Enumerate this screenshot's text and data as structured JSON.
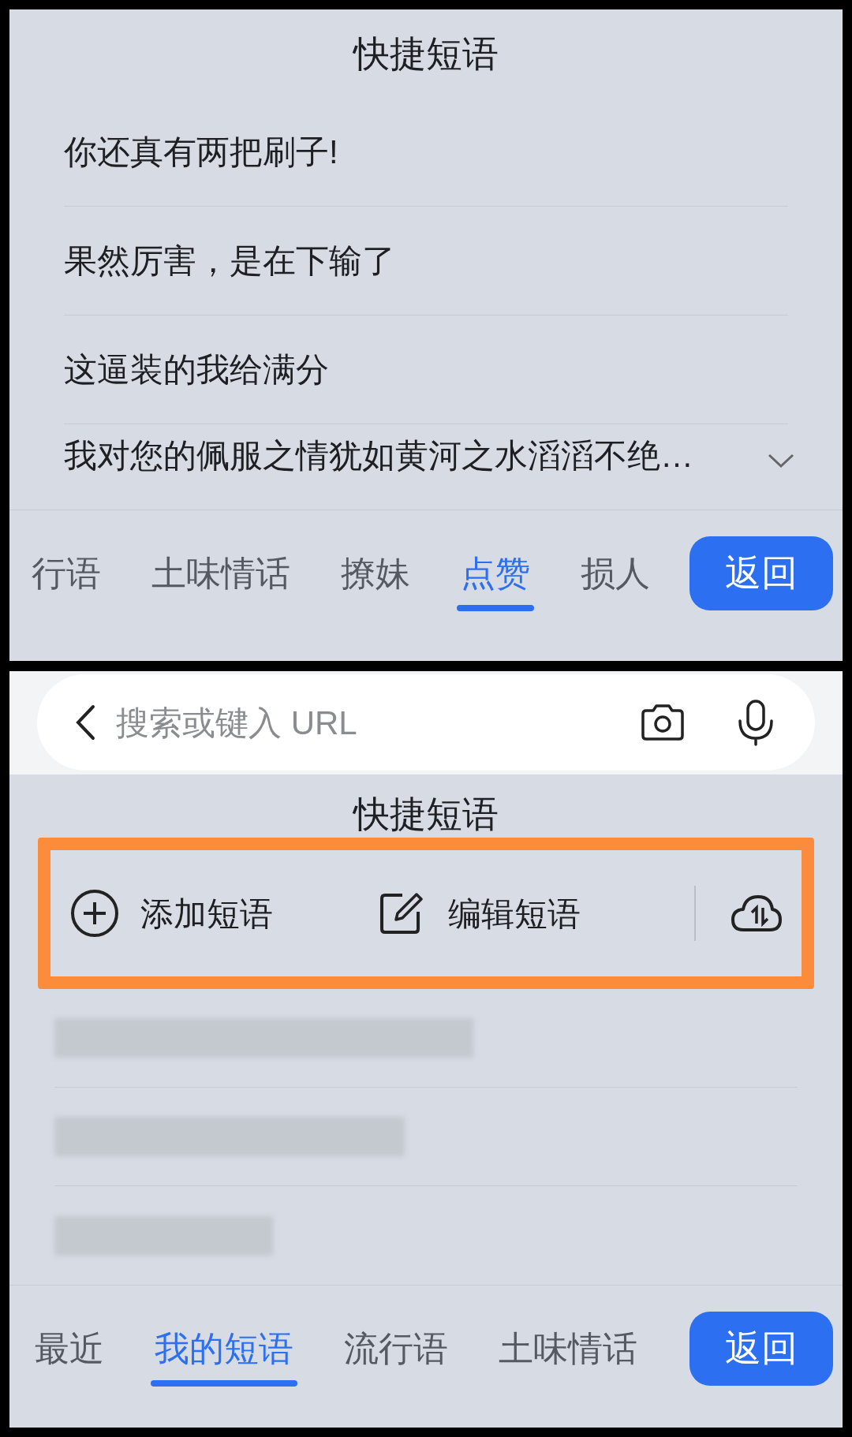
{
  "top_screen": {
    "title": "快捷短语",
    "phrases": [
      {
        "text": "你还真有两把刷子!",
        "expandable": false
      },
      {
        "text": "果然厉害，是在下输了",
        "expandable": false
      },
      {
        "text": "这逼装的我给满分",
        "expandable": false
      },
      {
        "text": "我对您的佩服之情犹如黄河之水滔滔不绝…",
        "expandable": true
      }
    ],
    "tabs": [
      {
        "label": "行语",
        "selected": false
      },
      {
        "label": "土味情话",
        "selected": false
      },
      {
        "label": "撩妹",
        "selected": false
      },
      {
        "label": "点赞",
        "selected": true
      },
      {
        "label": "损人",
        "selected": false
      }
    ],
    "back_button": "返回"
  },
  "bottom_screen": {
    "search_field": {
      "placeholder": "搜索或键入 URL"
    },
    "title": "快捷短语",
    "actions": [
      {
        "kind": "add",
        "label": "添加短语"
      },
      {
        "kind": "edit",
        "label": "编辑短语"
      },
      {
        "kind": "cloud"
      }
    ],
    "rows": [
      {
        "kind": "blurred"
      },
      {
        "kind": "blurred"
      },
      {
        "kind": "blurred"
      }
    ],
    "tabs": [
      {
        "label": "最近",
        "selected": false
      },
      {
        "label": "我的短语",
        "selected": true
      },
      {
        "label": "流行语",
        "selected": false
      },
      {
        "label": "土味情话",
        "selected": false
      }
    ],
    "back_button": "返回"
  }
}
